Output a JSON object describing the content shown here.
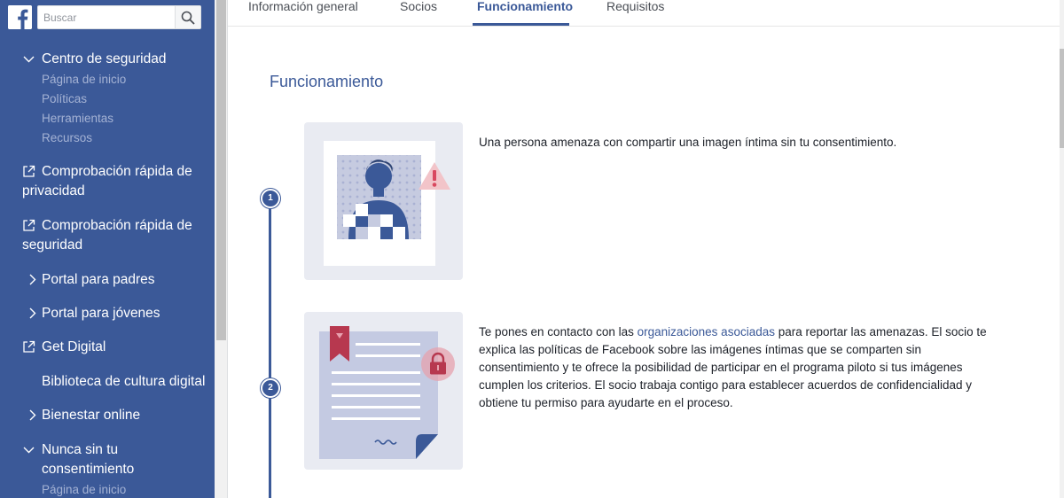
{
  "search": {
    "placeholder": "Buscar"
  },
  "sidebar": {
    "section1": {
      "label": "Centro de seguridad",
      "subitems": [
        "Página de inicio",
        "Políticas",
        "Herramientas",
        "Recursos"
      ]
    },
    "privacy_check": "Comprobación rápida de privacidad",
    "security_check": "Comprobación rápida de seguridad",
    "parents_portal": "Portal para padres",
    "youth_portal": "Portal para jóvenes",
    "get_digital": "Get Digital",
    "digital_library": "Biblioteca de cultura digital",
    "wellbeing": "Bienestar online",
    "section2": {
      "label": "Nunca sin tu consentimiento",
      "subitems": [
        "Página de inicio"
      ]
    }
  },
  "tabs": [
    "Información general",
    "Socios",
    "Funcionamiento",
    "Requisitos"
  ],
  "active_tab": "Funcionamiento",
  "main": {
    "title": "Funcionamiento",
    "steps": [
      {
        "number": "1",
        "text": "Una persona amenaza con compartir una imagen íntima sin tu consentimiento."
      },
      {
        "number": "2",
        "text_before": "Te pones en contacto con las ",
        "link": "organizaciones asociadas",
        "text_after": " para reportar las amenazas. El socio te explica las políticas de Facebook sobre las imágenes íntimas que se comparten sin consentimiento y te ofrece la posibilidad de participar en el programa piloto si tus imágenes cumplen los criterios. El socio trabaja contigo para establecer acuerdos de confidencialidad y obtiene tu permiso para ayudarte en el proceso."
      }
    ]
  },
  "colors": {
    "brand": "#3b5998",
    "sidebar_sub": "#a4b2d4",
    "warning": "#d9485f",
    "card_bg": "#e9ebf2"
  },
  "icons": {
    "logo": "facebook-logo-icon",
    "search": "search-icon",
    "expanded": "chevron-down-icon",
    "collapsed": "chevron-right-icon",
    "external": "external-link-icon",
    "warning": "warning-icon",
    "lock": "lock-icon"
  }
}
